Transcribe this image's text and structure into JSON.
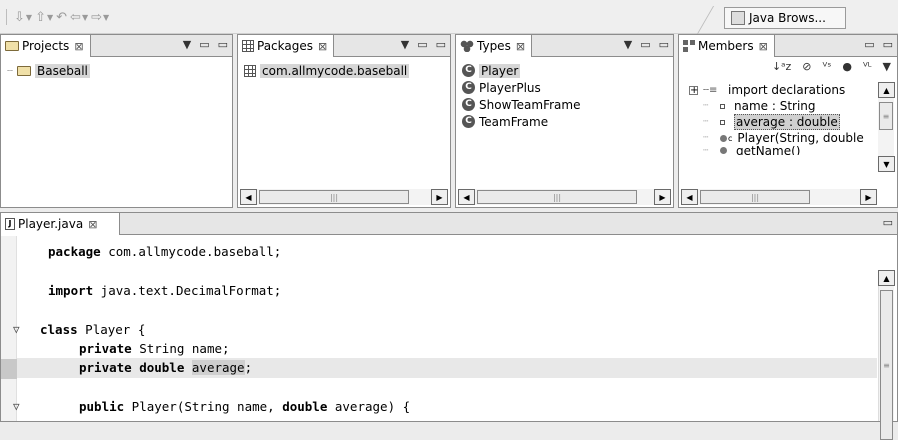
{
  "toolbar": {
    "perspective_label": "Java Brows..."
  },
  "views": {
    "projects": {
      "tab_label": "Projects",
      "items": [
        "Baseball"
      ]
    },
    "packages": {
      "tab_label": "Packages",
      "items": [
        "com.allmycode.baseball"
      ]
    },
    "types": {
      "tab_label": "Types",
      "items": [
        "Player",
        "PlayerPlus",
        "ShowTeamFrame",
        "TeamFrame"
      ]
    },
    "members": {
      "tab_label": "Members",
      "items": [
        "import declarations",
        "name : String",
        "average : double",
        "Player(String, double",
        "getName()"
      ],
      "modifier_c": "c"
    }
  },
  "editor": {
    "tab_label": "Player.java",
    "lines": [
      {
        "kw": "package",
        "rest": " com.allmycode.baseball;"
      },
      {
        "kw": "",
        "rest": ""
      },
      {
        "kw": "import",
        "rest": " java.text.DecimalFormat;"
      },
      {
        "kw": "",
        "rest": ""
      },
      {
        "kw": "class",
        "rest": " Player {"
      },
      {
        "kw": "private",
        "rest": " String name;"
      },
      {
        "kw": "private double",
        "rest": ""
      },
      {
        "kw": "",
        "rest": ""
      },
      {
        "kw": "public",
        "rest": " Player(String name, "
      }
    ],
    "highlight_word": "average",
    "line7_tail": ";",
    "line9_kw2": "double",
    "line9_tail": " average) {"
  },
  "glyphs": {
    "close": "⊠",
    "minimize": "▭",
    "maximize": "▭",
    "menu": "▾",
    "left": "◀",
    "right": "▶",
    "up": "▲",
    "down": "▼",
    "fold_open": "▽"
  }
}
